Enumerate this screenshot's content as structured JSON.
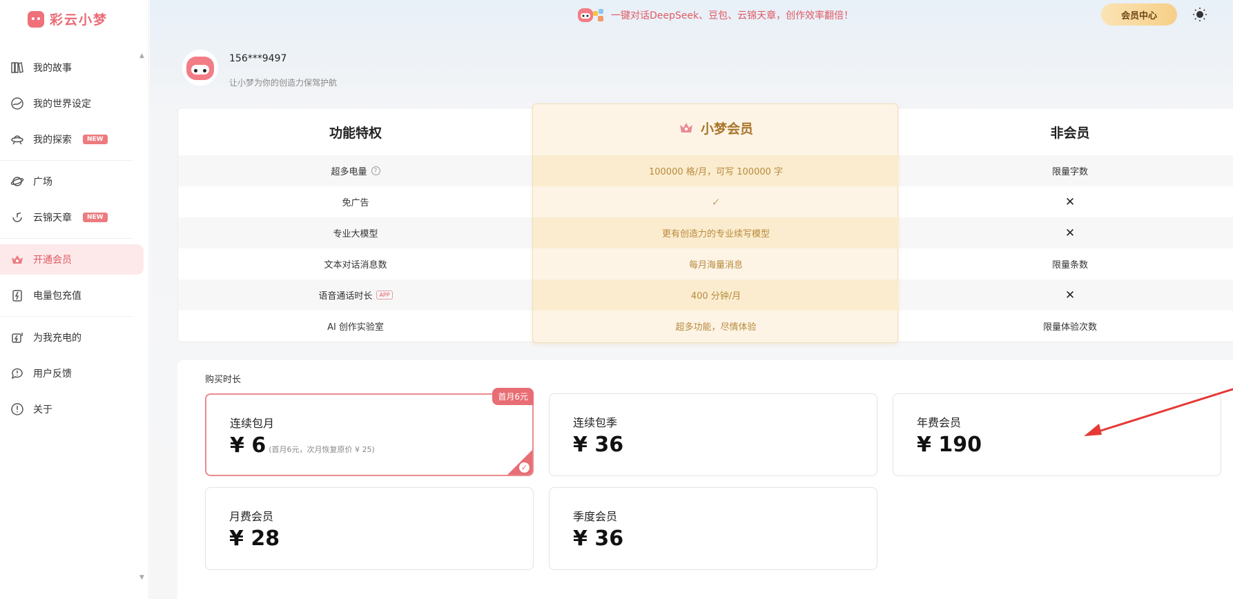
{
  "app": {
    "name": "彩云小梦"
  },
  "sidebar": {
    "items": [
      {
        "label": "我的故事",
        "icon": "books-icon"
      },
      {
        "label": "我的世界设定",
        "icon": "globe-icon"
      },
      {
        "label": "我的探索",
        "icon": "ufo-icon",
        "badge": "NEW"
      },
      {
        "label": "广场",
        "icon": "planet-icon"
      },
      {
        "label": "云锦天章",
        "icon": "sprout-icon",
        "badge": "NEW"
      },
      {
        "label": "开通会员",
        "icon": "crown-icon",
        "active": true
      },
      {
        "label": "电量包充值",
        "icon": "battery-icon"
      },
      {
        "label": "为我充电的",
        "icon": "charge-icon"
      },
      {
        "label": "用户反馈",
        "icon": "feedback-icon"
      },
      {
        "label": "关于",
        "icon": "info-icon"
      }
    ]
  },
  "topbar": {
    "promo_text": "一键对话DeepSeek、豆包、云锦天章，创作效率翻倍！",
    "member_center_label": "会员中心"
  },
  "profile": {
    "phone": "156***9497",
    "tagline": "让小梦为你的创造力保驾护航"
  },
  "features": {
    "headers": {
      "feature": "功能特权",
      "member": "小梦会员",
      "non_member": "非会员"
    },
    "rows": [
      {
        "feature": "超多电量",
        "member": "100000 格/月，可写 100000 字",
        "non_member": "限量字数",
        "extra": "question"
      },
      {
        "feature": "免广告",
        "member": "✓",
        "non_member": "✕"
      },
      {
        "feature": "专业大模型",
        "member": "更有创造力的专业续写模型",
        "non_member": "✕"
      },
      {
        "feature": "文本对话消息数",
        "member": "每月海量消息",
        "non_member": "限量条数"
      },
      {
        "feature": "语音通话时长",
        "member": "400 分钟/月",
        "non_member": "✕",
        "tag": "APP"
      },
      {
        "feature": "AI 创作实验室",
        "member": "超多功能，尽情体验",
        "non_member": "限量体验次数"
      }
    ]
  },
  "purchase": {
    "title": "购买时长",
    "plans": [
      {
        "name": "连续包月",
        "price": "¥ 6",
        "note": "(首月6元，次月恢复原价 ¥ 25)",
        "badge": "首月6元",
        "selected": true
      },
      {
        "name": "连续包季",
        "price": "¥ 36"
      },
      {
        "name": "年费会员",
        "price": "¥ 190"
      },
      {
        "name": "月费会员",
        "price": "¥ 28"
      },
      {
        "name": "季度会员",
        "price": "¥ 36"
      }
    ]
  },
  "colors": {
    "accent": "#e86d74",
    "gold": "#b88a3c",
    "member_bg": "#fdf4e6"
  }
}
